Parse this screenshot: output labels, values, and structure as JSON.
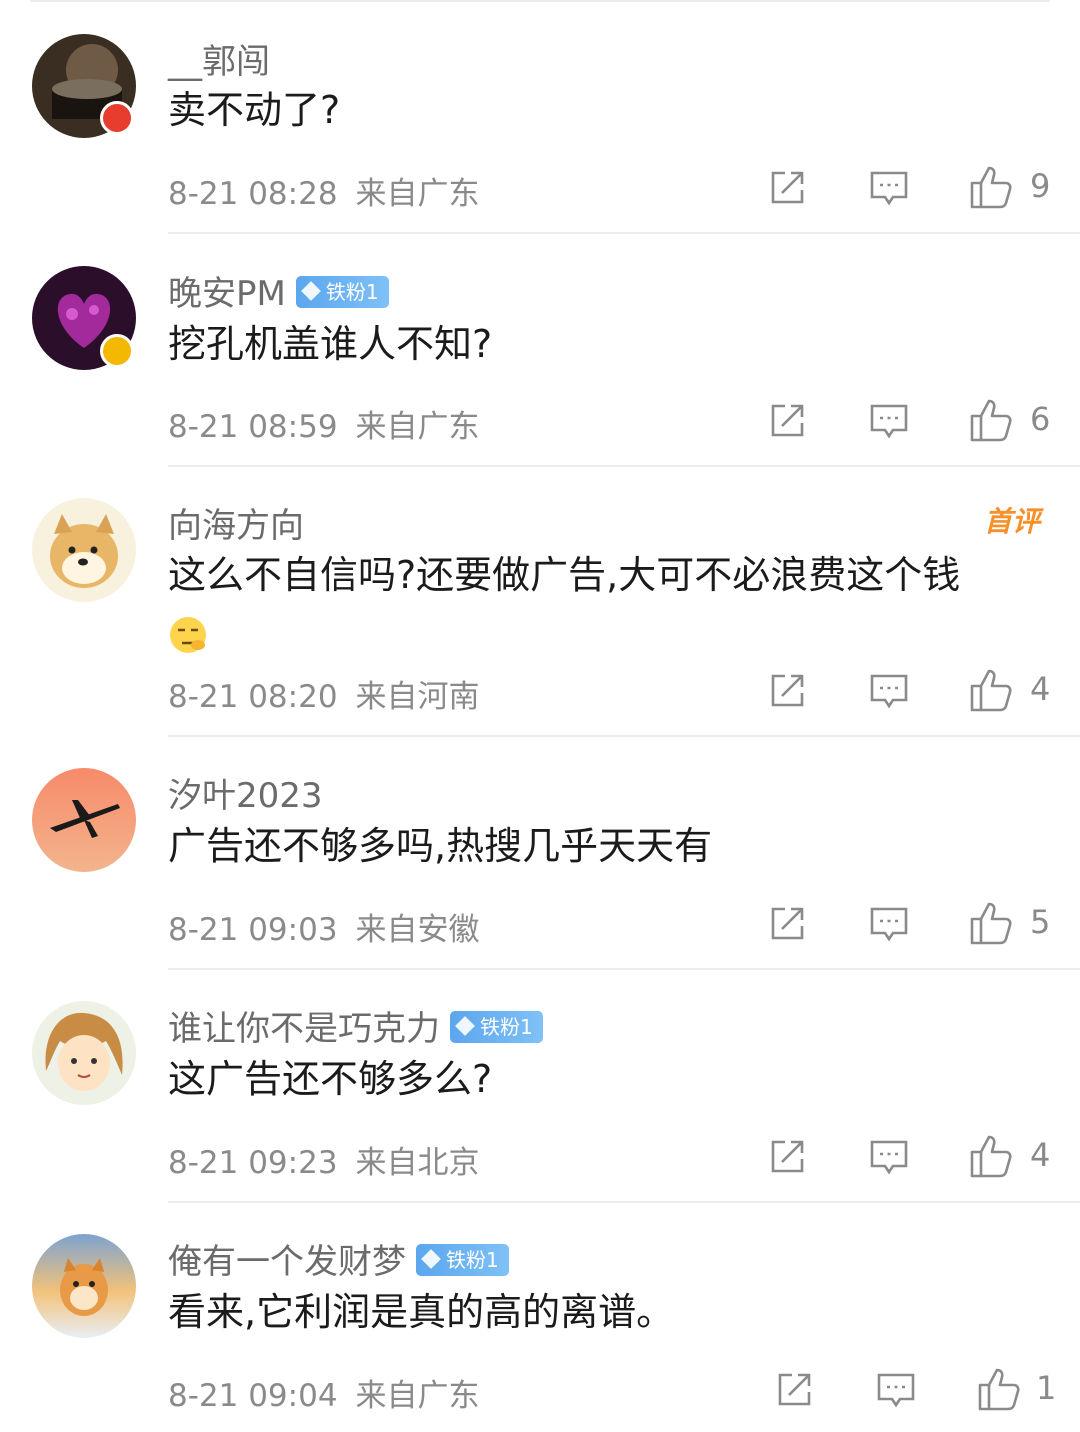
{
  "comments": [
    {
      "username": "__郭闯",
      "fan_badge": null,
      "text": "卖不动了?",
      "date": "8-21 08:28",
      "location": "来自广东",
      "likes": "9"
    },
    {
      "username": "晚安PM",
      "fan_badge": "铁粉1",
      "text": "挖孔机盖谁人不知?",
      "date": "8-21 08:59",
      "location": "来自广东",
      "likes": "6"
    },
    {
      "username": "向海方向",
      "fan_badge": null,
      "tag": "首评",
      "text": "这么不自信吗?还要做广告,大可不必浪费这个钱",
      "date": "8-21 08:20",
      "location": "来自河南",
      "likes": "4"
    },
    {
      "username": "汐叶2023",
      "fan_badge": null,
      "text": "广告还不够多吗,热搜几乎天天有",
      "date": "8-21 09:03",
      "location": "来自安徽",
      "likes": "5"
    },
    {
      "username": "谁让你不是巧克力",
      "fan_badge": "铁粉1",
      "text": "这广告还不够多么?",
      "date": "8-21 09:23",
      "location": "来自北京",
      "likes": "4"
    },
    {
      "username": "俺有一个发财梦",
      "fan_badge": "铁粉1",
      "text": "看来,它利润是真的高的离谱。",
      "date": "8-21 09:04",
      "location": "来自广东",
      "likes": "1"
    }
  ],
  "icons": {
    "share": "share-icon",
    "comment": "comment-icon",
    "like": "thumbs-up-icon"
  },
  "colors": {
    "meta_gray": "#8a8a8a",
    "fan_badge_blue": "#5ca6ee",
    "top_tag_orange": "#f7902a"
  }
}
